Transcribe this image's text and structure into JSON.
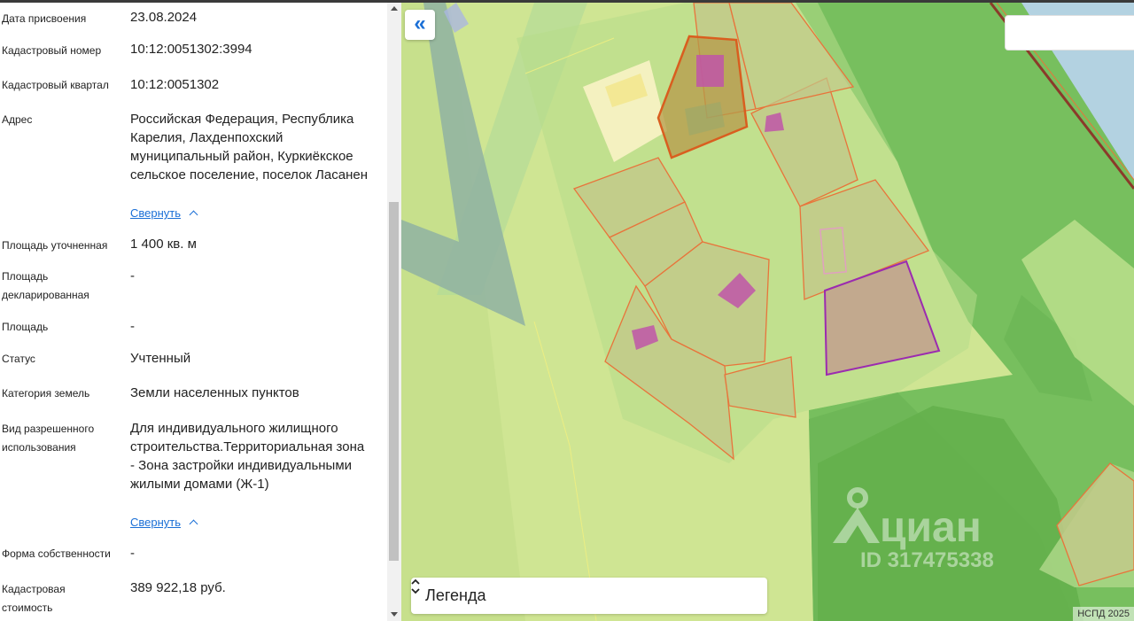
{
  "fields": [
    {
      "label": "Дата присвоения",
      "value": "23.08.2024"
    },
    {
      "label": "Кадастровый номер",
      "value": "10:12:0051302:3994"
    },
    {
      "label": "Кадастровый квартал",
      "value": "10:12:0051302"
    },
    {
      "label": "Адрес",
      "value": "Российская Федерация, Республика Карелия, Лахденпохский муниципальный район, Куркиёкское сельское поселение, поселок Ласанен"
    },
    {
      "label": "Площадь уточненная",
      "value": "1 400 кв. м"
    },
    {
      "label": "Площадь декларированная",
      "value": "-"
    },
    {
      "label": "Площадь",
      "value": "-"
    },
    {
      "label": "Статус",
      "value": "Учтенный"
    },
    {
      "label": "Категория земель",
      "value": "Земли населенных пунктов"
    },
    {
      "label": "Вид разрешенного использования",
      "value": "Для индивидуального жилищного строительства.Территориальная зона - Зона застройки индивидуальными жилыми домами (Ж-1)"
    },
    {
      "label": "Форма собственности",
      "value": "-"
    },
    {
      "label": "Кадастровая стоимость",
      "value": "389 922,18 руб."
    }
  ],
  "collapse_label": "Свернуть",
  "map": {
    "collapse_icon": "«",
    "legend_label": "Легенда",
    "credit": "НСПД 2025",
    "watermark_brand": "циан",
    "watermark_id": "ID 317475338"
  },
  "colors": {
    "link": "#1a6fd6",
    "map_base": "#cfe593",
    "forest": "#77bf5e",
    "parcel_border": "#e8743b",
    "selected_parcel": "#9b2bb0",
    "building": "#c055a8"
  }
}
